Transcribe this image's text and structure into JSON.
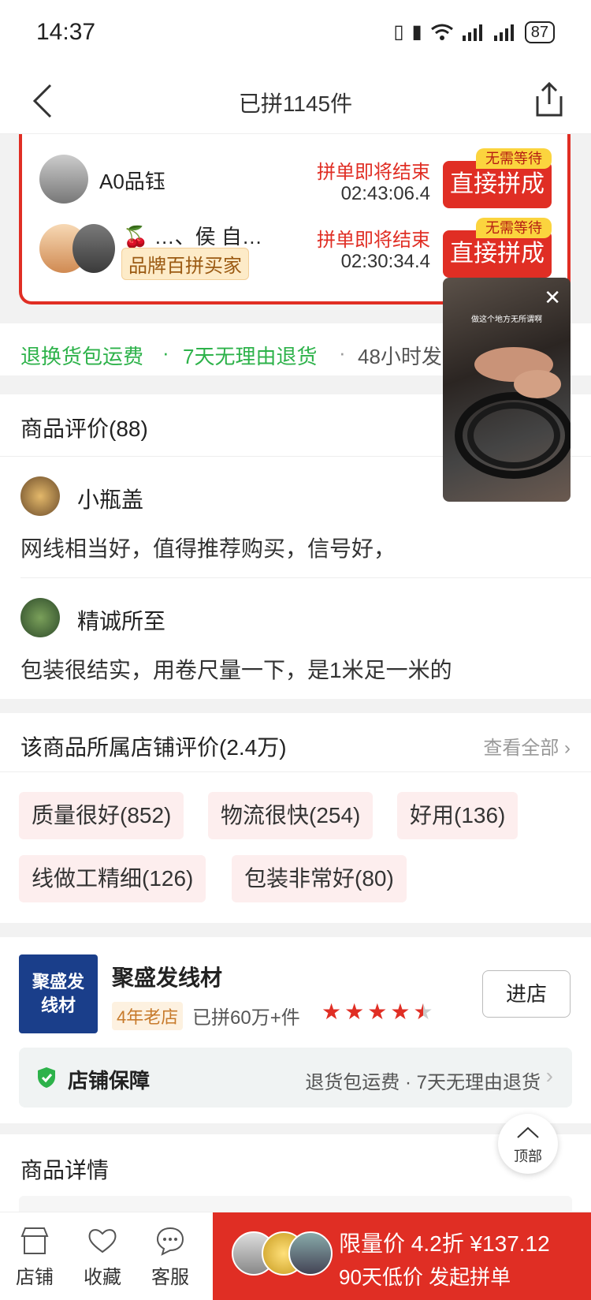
{
  "status": {
    "time": "14:37",
    "battery": "87"
  },
  "nav": {
    "title": "已拼1145件"
  },
  "groups": [
    {
      "name": "A0品钰",
      "ending": "拼单即将结束",
      "timer": "02:43:06.4",
      "tag": "无需等待",
      "button": "直接拼成"
    },
    {
      "name": "🍒 …、侯 自…",
      "badge": "品牌百拼买家",
      "ending": "拼单即将结束",
      "timer": "02:30:34.4",
      "tag": "无需等待",
      "button": "直接拼成"
    }
  ],
  "guarantees": {
    "g1": "退换货包运费",
    "sep1": "·",
    "g2": "7天无理由退货",
    "sep2": "·",
    "g3": "48小时发"
  },
  "reviews": {
    "title": "商品评价(88)",
    "items": [
      {
        "user": "小瓶盖",
        "text": "网线相当好，值得推荐购买，信号好，"
      },
      {
        "user": "精诚所至",
        "text": "包装很结实，用卷尺量一下，是1米足一米的"
      }
    ]
  },
  "store_reviews": {
    "title": "该商品所属店铺评价(2.4万)",
    "see_all": "查看全部",
    "tags": [
      "质量很好(852)",
      "物流很快(254)",
      "好用(136)",
      "线做工精细(126)",
      "包装非常好(80)"
    ]
  },
  "store": {
    "logo_text_1": "聚盛发",
    "logo_text_2": "线材",
    "name": "聚盛发线材",
    "age": "4年老店",
    "sales": "已拼60万+件",
    "rating": 4.5,
    "enter": "进店",
    "guarantee_title": "店铺保障",
    "guarantee_text": "退货包运费 · 7天无理由退货"
  },
  "details": {
    "title": "商品详情"
  },
  "to_top": "顶部",
  "video": {
    "caption": "做这个地方无所谓啊"
  },
  "bottom": {
    "store": "店铺",
    "favorite": "收藏",
    "service": "客服",
    "buy_line1": "限量价  4.2折 ¥137.12",
    "buy_line2": "90天低价 发起拼单"
  },
  "colors": {
    "accent": "#e02e24",
    "green": "#2db24a",
    "store_blue": "#1a3e8a"
  }
}
